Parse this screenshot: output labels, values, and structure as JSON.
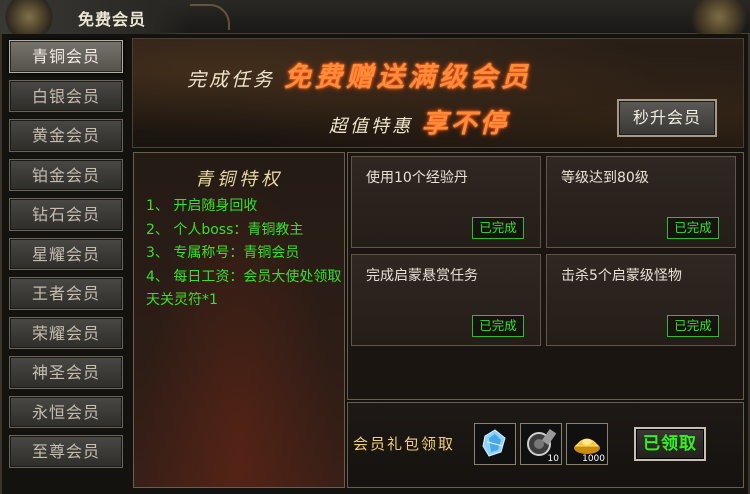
{
  "window": {
    "title": "免费会员"
  },
  "sidebar": {
    "items": [
      {
        "label": "青铜会员",
        "active": true
      },
      {
        "label": "白银会员",
        "active": false
      },
      {
        "label": "黄金会员",
        "active": false
      },
      {
        "label": "铂金会员",
        "active": false
      },
      {
        "label": "钻石会员",
        "active": false
      },
      {
        "label": "星耀会员",
        "active": false
      },
      {
        "label": "王者会员",
        "active": false
      },
      {
        "label": "荣耀会员",
        "active": false
      },
      {
        "label": "神圣会员",
        "active": false
      },
      {
        "label": "永恒会员",
        "active": false
      },
      {
        "label": "至尊会员",
        "active": false
      }
    ]
  },
  "banner": {
    "line1_prefix": "完成任务",
    "line1_highlight": "免费赠送满级会员",
    "line2_prefix": "超值特惠",
    "line2_highlight": "享不停",
    "upgrade_button": "秒升会员"
  },
  "privilege": {
    "title": "青铜特权",
    "items": [
      "1、 开启随身回收",
      "2、 个人boss：青铜教主",
      "3、 专属称号：青铜会员",
      "4、 每日工资：会员大使处领取天关灵符*1"
    ]
  },
  "tasks": [
    {
      "text": "使用10个经验丹",
      "status": "已完成"
    },
    {
      "text": "等级达到80级",
      "status": "已完成"
    },
    {
      "text": "完成启蒙悬赏任务",
      "status": "已完成"
    },
    {
      "text": "击杀5个启蒙级怪物",
      "status": "已完成"
    }
  ],
  "gift": {
    "label": "会员礼包领取",
    "items": [
      {
        "icon": "blue-crystal-icon",
        "count": ""
      },
      {
        "icon": "potion-bottle-icon",
        "count": "10"
      },
      {
        "icon": "gold-ingot-icon",
        "count": "1000"
      }
    ],
    "claim_button": "已领取"
  },
  "colors": {
    "accent_green": "#36e02c",
    "highlight_orange": "#ff8c3a",
    "gold_label": "#f0cf7a"
  }
}
